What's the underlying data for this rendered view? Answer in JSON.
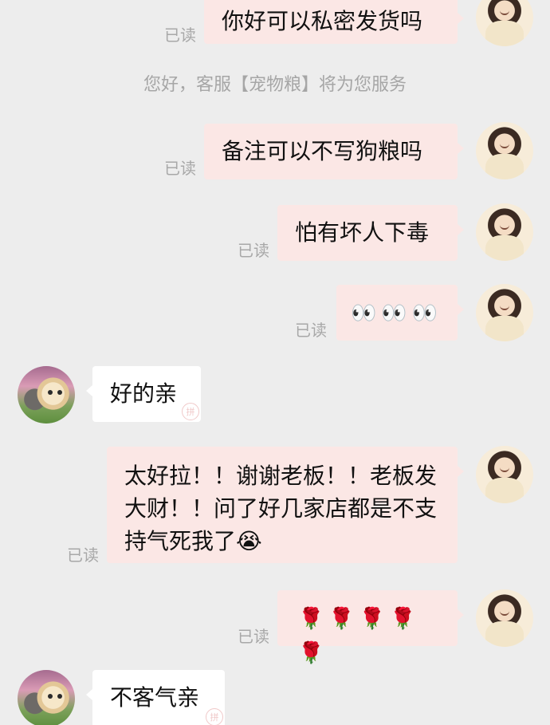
{
  "read_label": "已读",
  "system_notice": "您好，客服【宠物粮】将为您服务",
  "messages": [
    {
      "side": "out",
      "text": "你好可以私密发货吗"
    },
    {
      "side": "out",
      "text": "备注可以不写狗粮吗"
    },
    {
      "side": "out",
      "text": "怕有坏人下毒"
    },
    {
      "side": "out",
      "text": "👀👀👀"
    },
    {
      "side": "in",
      "text": "好的亲"
    },
    {
      "side": "out",
      "text": "太好拉！！谢谢老板！！老板发大财！！问了好几家店都是不支持气死我了😭"
    },
    {
      "side": "out",
      "text": "🌹🌹🌹🌹🌹"
    },
    {
      "side": "in",
      "text": "不客气亲"
    }
  ],
  "watermark": "拼",
  "colors": {
    "background": "#ededed",
    "outgoing_bubble": "#fbe7e5",
    "incoming_bubble": "#ffffff",
    "read_text": "#a8a8a8"
  }
}
